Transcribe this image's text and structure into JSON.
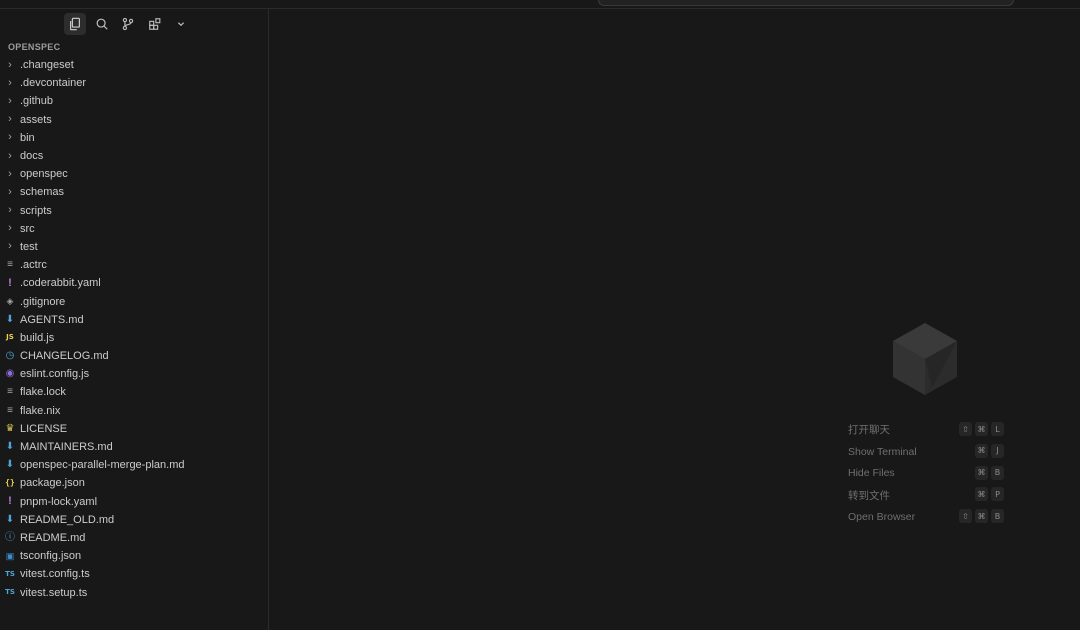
{
  "explorer": {
    "section_title": "OPENSPEC",
    "items": [
      {
        "name": ".changeset",
        "type": "folder",
        "icon": "chevron-right-icon"
      },
      {
        "name": ".devcontainer",
        "type": "folder",
        "icon": "chevron-right-icon"
      },
      {
        "name": ".github",
        "type": "folder",
        "icon": "chevron-right-icon"
      },
      {
        "name": "assets",
        "type": "folder",
        "icon": "chevron-right-icon"
      },
      {
        "name": "bin",
        "type": "folder",
        "icon": "chevron-right-icon"
      },
      {
        "name": "docs",
        "type": "folder",
        "icon": "chevron-right-icon"
      },
      {
        "name": "openspec",
        "type": "folder",
        "icon": "chevron-right-icon"
      },
      {
        "name": "schemas",
        "type": "folder",
        "icon": "chevron-right-icon"
      },
      {
        "name": "scripts",
        "type": "folder",
        "icon": "chevron-right-icon"
      },
      {
        "name": "src",
        "type": "folder",
        "icon": "chevron-right-icon"
      },
      {
        "name": "test",
        "type": "folder",
        "icon": "chevron-right-icon"
      },
      {
        "name": ".actrc",
        "type": "file",
        "icon": "text-lines-icon"
      },
      {
        "name": ".coderabbit.yaml",
        "type": "file",
        "icon": "yaml-exclamation-icon"
      },
      {
        "name": ".gitignore",
        "type": "file",
        "icon": "git-diamond-icon"
      },
      {
        "name": "AGENTS.md",
        "type": "file",
        "icon": "markdown-down-arrow-icon"
      },
      {
        "name": "build.js",
        "type": "file",
        "icon": "js-icon"
      },
      {
        "name": "CHANGELOG.md",
        "type": "file",
        "icon": "changelog-clock-icon"
      },
      {
        "name": "eslint.config.js",
        "type": "file",
        "icon": "eslint-icon"
      },
      {
        "name": "flake.lock",
        "type": "file",
        "icon": "text-lines-icon"
      },
      {
        "name": "flake.nix",
        "type": "file",
        "icon": "text-lines-icon"
      },
      {
        "name": "LICENSE",
        "type": "file",
        "icon": "license-ribbon-icon"
      },
      {
        "name": "MAINTAINERS.md",
        "type": "file",
        "icon": "markdown-down-arrow-icon"
      },
      {
        "name": "openspec-parallel-merge-plan.md",
        "type": "file",
        "icon": "markdown-down-arrow-icon"
      },
      {
        "name": "package.json",
        "type": "file",
        "icon": "json-braces-icon"
      },
      {
        "name": "pnpm-lock.yaml",
        "type": "file",
        "icon": "yaml-exclamation-icon"
      },
      {
        "name": "README_OLD.md",
        "type": "file",
        "icon": "markdown-down-arrow-icon"
      },
      {
        "name": "README.md",
        "type": "file",
        "icon": "readme-info-icon"
      },
      {
        "name": "tsconfig.json",
        "type": "file",
        "icon": "tsconfig-icon"
      },
      {
        "name": "vitest.config.ts",
        "type": "file",
        "icon": "typescript-icon"
      },
      {
        "name": "vitest.setup.ts",
        "type": "file",
        "icon": "typescript-icon"
      }
    ]
  },
  "toolbar": {
    "buttons": [
      {
        "icon": "files-icon",
        "active": true
      },
      {
        "icon": "search-icon",
        "active": false
      },
      {
        "icon": "source-control-icon",
        "active": false
      },
      {
        "icon": "extensions-icon",
        "active": false
      },
      {
        "icon": "chevron-down-icon",
        "active": false
      }
    ]
  },
  "empty_editor": {
    "logo_icon": "cursor-cube-logo-icon",
    "shortcuts": [
      {
        "label": "打开聊天",
        "keys": [
          "⇧",
          "⌘",
          "L"
        ]
      },
      {
        "label": "Show Terminal",
        "keys": [
          "⌘",
          "J"
        ]
      },
      {
        "label": "Hide Files",
        "keys": [
          "⌘",
          "B"
        ]
      },
      {
        "label": "转到文件",
        "keys": [
          "⌘",
          "P"
        ]
      },
      {
        "label": "Open Browser",
        "keys": [
          "⇧",
          "⌘",
          "B"
        ]
      }
    ]
  },
  "colors": {
    "background": "#181818",
    "border": "#2b2b2b",
    "text": "#cccccc",
    "muted_text": "#6f6f6f",
    "markdown_blue": "#4fa3d8",
    "js_yellow": "#e7d34d",
    "yaml_purple": "#b77fd8"
  }
}
